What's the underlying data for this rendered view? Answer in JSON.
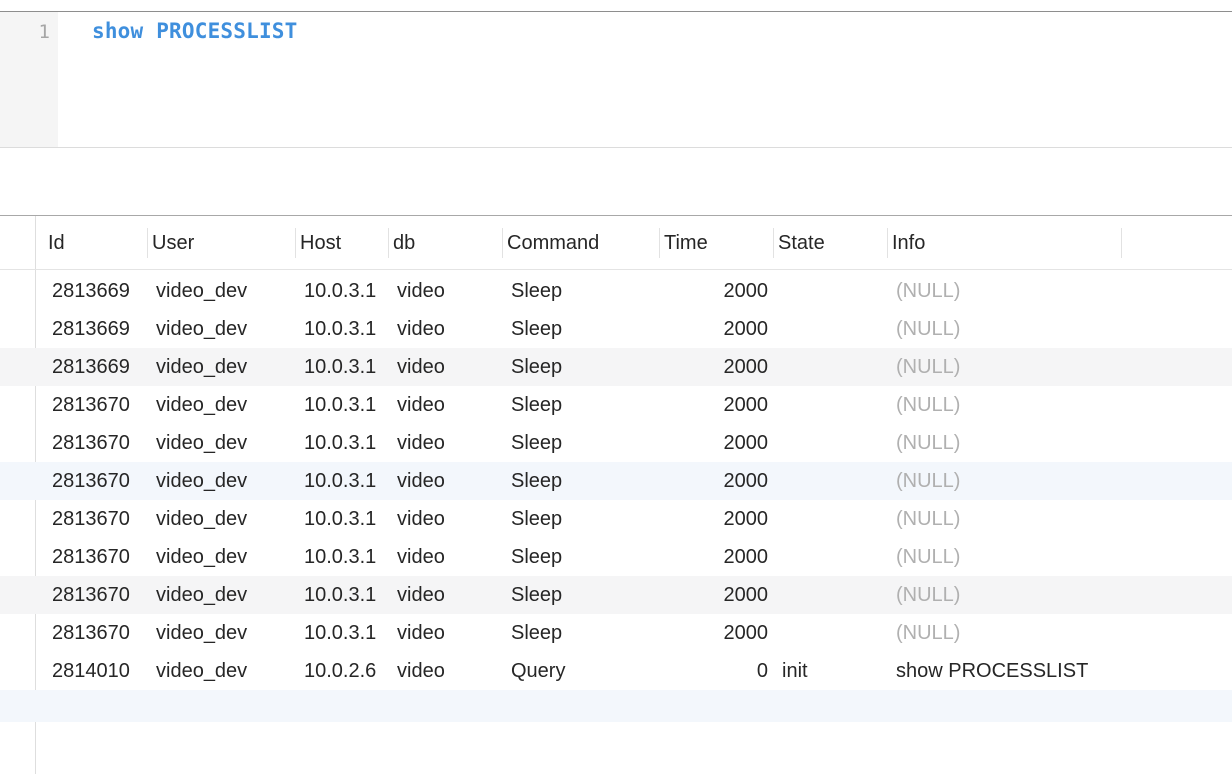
{
  "editor": {
    "line_number": "1",
    "code_keyword": "show",
    "code_rest": "PROCESSLIST"
  },
  "results": {
    "columns": [
      "Id",
      "User",
      "Host",
      "db",
      "Command",
      "Time",
      "State",
      "Info"
    ],
    "rows": [
      {
        "id": "2813669",
        "user": "video_dev",
        "host": "10.0.3.1",
        "db": "video",
        "command": "Sleep",
        "time": "2000",
        "state": "",
        "info": "(NULL)"
      },
      {
        "id": "2813669",
        "user": "video_dev",
        "host": "10.0.3.1",
        "db": "video",
        "command": "Sleep",
        "time": "2000",
        "state": "",
        "info": "(NULL)"
      },
      {
        "id": "2813669",
        "user": "video_dev",
        "host": "10.0.3.1",
        "db": "video",
        "command": "Sleep",
        "time": "2000",
        "state": "",
        "info": "(NULL)"
      },
      {
        "id": "2813670",
        "user": "video_dev",
        "host": "10.0.3.1",
        "db": "video",
        "command": "Sleep",
        "time": "2000",
        "state": "",
        "info": "(NULL)"
      },
      {
        "id": "2813670",
        "user": "video_dev",
        "host": "10.0.3.1",
        "db": "video",
        "command": "Sleep",
        "time": "2000",
        "state": "",
        "info": "(NULL)"
      },
      {
        "id": "2813670",
        "user": "video_dev",
        "host": "10.0.3.1",
        "db": "video",
        "command": "Sleep",
        "time": "2000",
        "state": "",
        "info": "(NULL)"
      },
      {
        "id": "2813670",
        "user": "video_dev",
        "host": "10.0.3.1",
        "db": "video",
        "command": "Sleep",
        "time": "2000",
        "state": "",
        "info": "(NULL)"
      },
      {
        "id": "2813670",
        "user": "video_dev",
        "host": "10.0.3.1",
        "db": "video",
        "command": "Sleep",
        "time": "2000",
        "state": "",
        "info": "(NULL)"
      },
      {
        "id": "2813670",
        "user": "video_dev",
        "host": "10.0.3.1",
        "db": "video",
        "command": "Sleep",
        "time": "2000",
        "state": "",
        "info": "(NULL)"
      },
      {
        "id": "2813670",
        "user": "video_dev",
        "host": "10.0.3.1",
        "db": "video",
        "command": "Sleep",
        "time": "2000",
        "state": "",
        "info": "(NULL)"
      },
      {
        "id": "2814010",
        "user": "video_dev",
        "host": "10.0.2.6",
        "db": "video",
        "command": "Query",
        "time": "0",
        "state": "init",
        "info": "show PROCESSLIST"
      }
    ]
  },
  "colors": {
    "keyword": "#3f8fdd",
    "null_text": "#b0b0b0",
    "stripe": "#f5f5f6",
    "selected_stripe": "#f3f7fc"
  }
}
